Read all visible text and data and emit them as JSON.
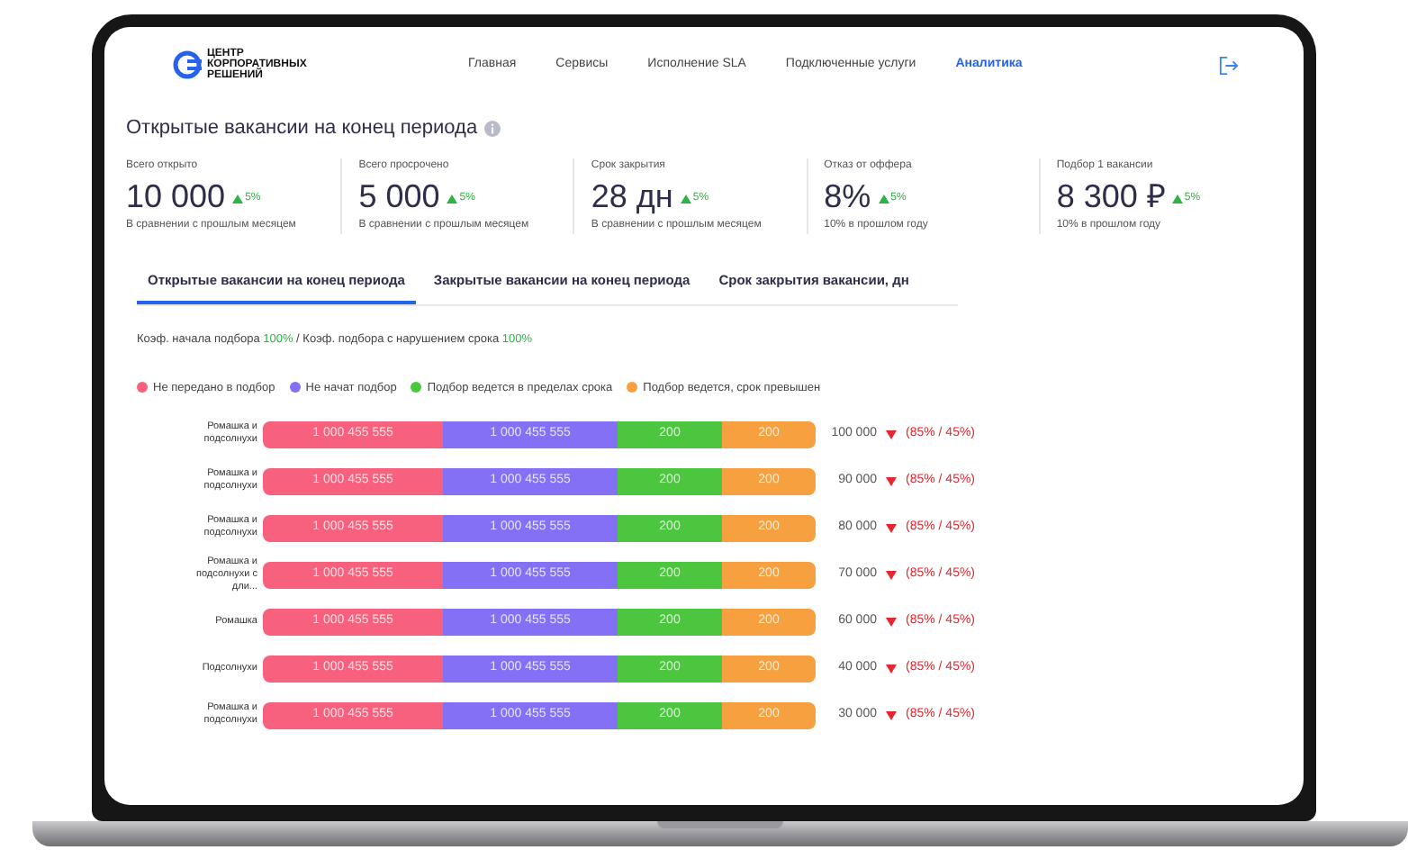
{
  "logo": {
    "text": "ЦЕНТР КОРПОРАТИВНЫХ РЕШЕНИЙ"
  },
  "nav": [
    {
      "label": "Главная",
      "selected": false
    },
    {
      "label": "Сервисы",
      "selected": false
    },
    {
      "label": "Исполнение SLA",
      "selected": false
    },
    {
      "label": "Подключенные услуги",
      "selected": false
    },
    {
      "label": "Аналитика",
      "selected": true
    }
  ],
  "page_title": "Открытые вакансии на конец периода",
  "stats": [
    {
      "label": "Всего открыто",
      "value": "10 000",
      "delta": "5%",
      "kind": "up",
      "note": "В сравнении с прошлым месяцем"
    },
    {
      "label": "Всего просрочено",
      "value": "5 000",
      "delta": "5%",
      "kind": "up",
      "note": "В сравнении с прошлым месяцем"
    },
    {
      "label": "Срок закрытия",
      "value": "28 дн",
      "delta": "5%",
      "kind": "up",
      "note": "В сравнении с прошлым месяцем"
    },
    {
      "label": "Отказ от оффера",
      "value": "8%",
      "delta": "5%",
      "kind": "up",
      "note": "10% в прошлом году"
    },
    {
      "label": "Подбор 1 вакансии",
      "value": "8 300 ₽",
      "delta": "5%",
      "kind": "up",
      "note": "10% в прошлом году"
    }
  ],
  "tabs": [
    {
      "label": "Открытые вакансии на конец периода",
      "selected": true
    },
    {
      "label": "Закрытые вакансии на конец периода",
      "selected": false
    },
    {
      "label": "Срок закрытия вакансии, дн",
      "selected": false
    }
  ],
  "coefficients": "Коэф. начала подбора **100%** / Коэф. подбора с нарушением срока **100%**",
  "legend": [
    {
      "label": "Не передано в подбор",
      "color": "#f7617d"
    },
    {
      "label": "Не начат подбор",
      "color": "#8370f5"
    },
    {
      "label": "Подбор ведется в пределах срока",
      "color": "#4cc63f"
    },
    {
      "label": "Подбор ведется, срок превышен",
      "color": "#f7a040"
    }
  ],
  "rows": [
    {
      "name": "Ромашка и подсолнухи",
      "segments": [
        "1 000 455 555",
        "1 000 455 555",
        "200",
        "200"
      ],
      "total": "100 000",
      "kind": "down",
      "change": "(85% / 45%)"
    },
    {
      "name": "Ромашка и подсолнухи",
      "segments": [
        "1 000 455 555",
        "1 000 455 555",
        "200",
        "200"
      ],
      "total": "90 000",
      "kind": "down",
      "change": "(85% / 45%)"
    },
    {
      "name": "Ромашка и подсолнухи",
      "segments": [
        "1 000 455 555",
        "1 000 455 555",
        "200",
        "200"
      ],
      "total": "80 000",
      "kind": "down",
      "change": "(85% / 45%)"
    },
    {
      "name": "Ромашка и подсолнухи с дли...",
      "segments": [
        "1 000 455 555",
        "1 000 455 555",
        "200",
        "200"
      ],
      "total": "70 000",
      "kind": "down",
      "change": "(85% / 45%)"
    },
    {
      "name": "Ромашка",
      "segments": [
        "1 000 455 555",
        "1 000 455 555",
        "200",
        "200"
      ],
      "total": "60 000",
      "kind": "down",
      "change": "(85% / 45%)"
    },
    {
      "name": "Подсолнухи",
      "segments": [
        "1 000 455 555",
        "1 000 455 555",
        "200",
        "200"
      ],
      "total": "40 000",
      "kind": "down",
      "change": "(85% / 45%)"
    },
    {
      "name": "Ромашка и подсолнухи",
      "segments": [
        "1 000 455 555",
        "1 000 455 555",
        "200",
        "200"
      ],
      "total": "30 000",
      "kind": "down",
      "change": "(85% / 45%)"
    }
  ]
}
